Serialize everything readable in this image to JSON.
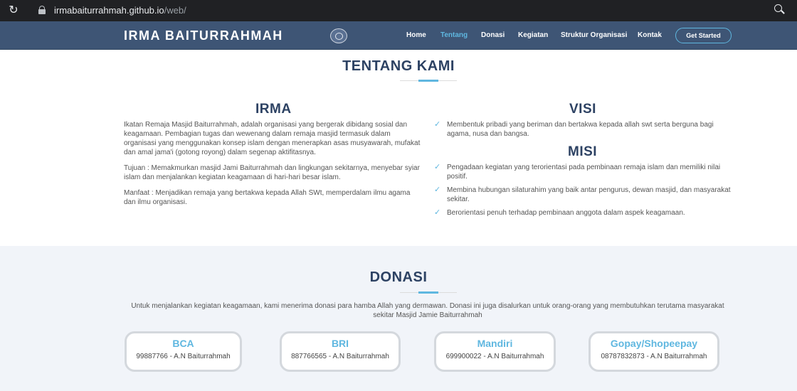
{
  "browser": {
    "url_domain": "irmabaiturrahmah.github.io",
    "url_path": "/web/",
    "reload_icon": "↻"
  },
  "nav": {
    "brand": "IRMA BAITURRAHMAH",
    "links": [
      {
        "label": "Home",
        "active": false
      },
      {
        "label": "Tentang",
        "active": true
      },
      {
        "label": "Donasi",
        "active": false
      },
      {
        "label": "Kegiatan",
        "active": false
      },
      {
        "label": "Struktur Organisasi",
        "active": false
      },
      {
        "label": "Kontak",
        "active": false
      }
    ],
    "cta": "Get Started"
  },
  "about": {
    "title": "TENTANG KAMI",
    "irma": {
      "heading": "IRMA",
      "paragraphs": [
        "Ikatan Remaja Masjid Baiturrahmah, adalah organisasi yang bergerak dibidang sosial dan keagamaan. Pembagian tugas dan wewenang dalam remaja masjid termasuk dalam organisasi yang menggunakan konsep islam dengan menerapkan asas musyawarah, mufakat dan amal jama'i (gotong royong) dalam segenap aktifitasnya.",
        "Tujuan : Memakmurkan masjid Jami Baiturrahmah dan lingkungan sekitarnya, menyebar syiar islam dan menjalankan kegiatan keagamaan di hari-hari besar islam.",
        "Manfaat : Menjadikan remaja yang bertakwa kepada Allah SWt, memperdalam ilmu agama dan ilmu organisasi."
      ]
    },
    "visi": {
      "heading": "VISI",
      "items": [
        "Membentuk pribadi yang beriman dan bertakwa kepada allah swt serta berguna bagi agama, nusa dan bangsa."
      ]
    },
    "misi": {
      "heading": "MISI",
      "items": [
        "Pengadaan kegiatan yang terorientasi pada pembinaan remaja islam dan memiliki nilai positif.",
        "Membina hubungan silaturahim yang baik antar pengurus, dewan masjid, dan masyarakat sekitar.",
        "Berorientasi penuh terhadap pembinaan anggota dalam aspek keagamaan."
      ]
    },
    "check_icon": "✓"
  },
  "donasi": {
    "title": "DONASI",
    "description": "Untuk menjalankan kegiatan keagamaan, kami menerima donasi para hamba Allah yang dermawan. Donasi ini juga disalurkan untuk orang-orang yang membutuhkan terutama masyarakat sekitar Masjid Jamie Baiturrahmah",
    "banks": [
      {
        "name": "BCA",
        "account": "99887766 - A.N Baiturrahmah"
      },
      {
        "name": "BRI",
        "account": "887766565 - A.N Baiturrahmah"
      },
      {
        "name": "Mandiri",
        "account": "699900022 - A.N Baiturrahmah"
      },
      {
        "name": "Gopay/Shopeepay",
        "account": "08787832873 - A.N Baiturrahmah"
      }
    ]
  },
  "colors": {
    "nav_bg": "#3e5575",
    "accent": "#5fb7e0",
    "heading": "#2d4263",
    "section_bg": "#f1f4f9"
  }
}
